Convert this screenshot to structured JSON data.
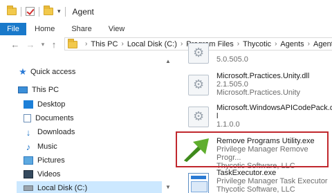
{
  "window": {
    "title": "Agent",
    "quick_access_arrow": "▾"
  },
  "ribbon": {
    "tabs": [
      "File",
      "Home",
      "Share",
      "View"
    ]
  },
  "address": {
    "crumbs": [
      "This PC",
      "Local Disk (C:)",
      "Program Files",
      "Thycotic",
      "Agents",
      "Agent"
    ]
  },
  "nav": {
    "items": [
      {
        "label": "Quick access",
        "icon": "star-icon"
      },
      {
        "label": "This PC",
        "icon": "computer-icon"
      },
      {
        "label": "Desktop",
        "icon": "desktop-folder-icon"
      },
      {
        "label": "Documents",
        "icon": "documents-folder-icon"
      },
      {
        "label": "Downloads",
        "icon": "downloads-folder-icon"
      },
      {
        "label": "Music",
        "icon": "music-folder-icon"
      },
      {
        "label": "Pictures",
        "icon": "pictures-folder-icon"
      },
      {
        "label": "Videos",
        "icon": "videos-folder-icon"
      },
      {
        "label": "Local Disk (C:)",
        "icon": "drive-icon"
      }
    ]
  },
  "files": [
    {
      "lines": [
        "5.0.505.0"
      ]
    },
    {
      "lines": [
        "Microsoft.Practices.Unity.dll",
        "2.1.505.0",
        "Microsoft.Practices.Unity"
      ]
    },
    {
      "lines": [
        "Microsoft.WindowsAPICodePack.dl",
        "l",
        "1.1.0.0"
      ]
    },
    {
      "lines": [
        "Remove Programs Utility.exe",
        "Privilege Manager Remove Progr...",
        "Thycotic Software, LLC"
      ]
    },
    {
      "lines": [
        "TaskExecutor.exe",
        "Privilege Manager Task Executor",
        "Thycotic Software, LLC"
      ]
    }
  ],
  "colors": {
    "accent": "#1979ca",
    "highlight_border": "#c0272d",
    "selected_bg": "#cce8ff"
  }
}
